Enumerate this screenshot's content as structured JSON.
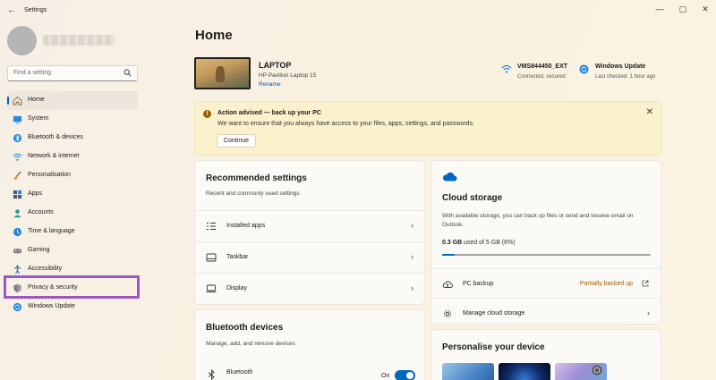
{
  "window": {
    "title": "Settings",
    "minimize": "—",
    "maximize": "▢",
    "close": "✕"
  },
  "search": {
    "placeholder": "Find a setting"
  },
  "sidebar": {
    "items": [
      {
        "label": "Home",
        "icon": "home-icon",
        "active": true
      },
      {
        "label": "System",
        "icon": "system-icon"
      },
      {
        "label": "Bluetooth & devices",
        "icon": "bluetooth-icon"
      },
      {
        "label": "Network & internet",
        "icon": "network-icon"
      },
      {
        "label": "Personalisation",
        "icon": "brush-icon"
      },
      {
        "label": "Apps",
        "icon": "apps-icon"
      },
      {
        "label": "Accounts",
        "icon": "accounts-icon"
      },
      {
        "label": "Time & language",
        "icon": "globe-clock-icon"
      },
      {
        "label": "Gaming",
        "icon": "gamepad-icon"
      },
      {
        "label": "Accessibility",
        "icon": "accessibility-icon"
      },
      {
        "label": "Privacy & security",
        "icon": "shield-icon",
        "highlighted": true
      },
      {
        "label": "Windows Update",
        "icon": "windows-update-icon"
      }
    ]
  },
  "page": {
    "title": "Home"
  },
  "device": {
    "name": "LAPTOP",
    "model": "HP Pavilion Laptop 15",
    "rename": "Rename"
  },
  "network": {
    "name": "VMS844450_EXT",
    "status": "Connected, secured"
  },
  "update": {
    "name": "Windows Update",
    "status": "Last checked: 1 hour ago"
  },
  "banner": {
    "title": "Action advised — back up your PC",
    "text": "We want to ensure that you always have access to your files, apps, settings, and passwords.",
    "button": "Continue",
    "close": "✕"
  },
  "recommended": {
    "title": "Recommended settings",
    "subtitle": "Recent and commonly used settings",
    "rows": [
      {
        "label": "Installed apps"
      },
      {
        "label": "Taskbar"
      },
      {
        "label": "Display"
      }
    ]
  },
  "bluetooth": {
    "title": "Bluetooth devices",
    "subtitle": "Manage, add, and remove devices",
    "label": "Bluetooth",
    "toggle_text": "On",
    "toggle_on": true
  },
  "cloud": {
    "title": "Cloud storage",
    "desc": "With available storage, you can back up files or send and receive email on Outlook.",
    "used": "0.3 GB",
    "total": "used of 5 GB (6%)",
    "fraction": 0.06,
    "backup_label": "PC backup",
    "backup_status": "Partially backed up",
    "manage_label": "Manage cloud storage"
  },
  "personalise": {
    "title": "Personalise your device"
  },
  "colors": {
    "accent": "#0067c0",
    "warning": "#9d5d00",
    "highlight": "#9b55c6",
    "backup_status": "#9d5d00"
  }
}
